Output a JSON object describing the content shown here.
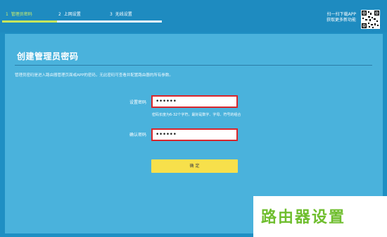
{
  "steps": [
    {
      "num": "1",
      "label": "管理员密码"
    },
    {
      "num": "2",
      "label": "上网设置"
    },
    {
      "num": "3",
      "label": "无线设置"
    }
  ],
  "app_promo": {
    "line1": "扫一扫下载APP",
    "line2": "获取更多新功能"
  },
  "title": "创建管理员密码",
  "description": "管理员密码是进入路由器管理页面或APP的密码，无此密码可查看并配置路由器的所有参数。",
  "fields": {
    "set_password": {
      "label": "设置密码",
      "value": "••••••"
    },
    "confirm_password": {
      "label": "确认密码",
      "value": "••••••"
    }
  },
  "hint": "密码长度为6-32个字符，最好是数字、字母、符号的组合",
  "ok_label": "确 定",
  "watermark": "路由器设置",
  "colors": {
    "header": "#1e8bc0",
    "panel": "#4ab2dc",
    "step_active": "#c6e55c",
    "button": "#f7e04b",
    "error_border": "#d9262c"
  }
}
